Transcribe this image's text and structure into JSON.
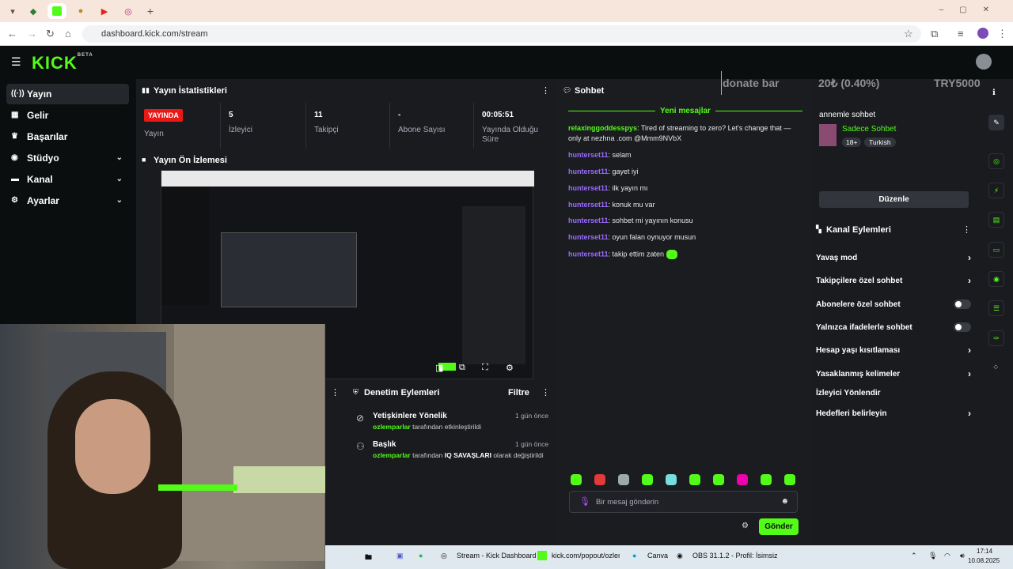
{
  "browser": {
    "url": "dashboard.kick.com/stream",
    "new_tab": "+"
  },
  "kick": {
    "logo": "KICK",
    "logo_sup": "BETA"
  },
  "sidebar": {
    "items": [
      {
        "label": "Yayın",
        "icon": "broadcast-icon"
      },
      {
        "label": "Gelir",
        "icon": "revenue-icon"
      },
      {
        "label": "Başarılar",
        "icon": "trophy-icon"
      },
      {
        "label": "Stüdyo",
        "icon": "studio-icon"
      },
      {
        "label": "Kanal",
        "icon": "channel-icon"
      },
      {
        "label": "Ayarlar",
        "icon": "gear-icon"
      }
    ]
  },
  "stats": {
    "title": "Yayın İstatistikleri",
    "live_badge": "YAYINDA",
    "live_label": "Yayın",
    "viewers_num": "5",
    "viewers_label": "İzleyici",
    "followers_num": "11",
    "followers_label": "Takipçi",
    "subs_num": "-",
    "subs_label": "Abone Sayısı",
    "uptime_num": "00:05:51",
    "uptime_label": "Yayında Olduğu Süre"
  },
  "preview": {
    "title": "Yayın Ön İzlemesi"
  },
  "mod": {
    "title": "Denetim Eylemleri",
    "filter": "Filtre",
    "actions": [
      {
        "title": "Yetişkinlere Yönelik",
        "time": "1 gün önce",
        "user": "ozlemparlar",
        "text": "tarafından etkinleştirildi"
      },
      {
        "title": "Başlık",
        "time": "1 gün önce",
        "user": "ozlemparlar",
        "text_pre": "tarafından",
        "bold": "IQ SAVAŞLARI",
        "text_post": "olarak değiştirildi"
      }
    ]
  },
  "chat": {
    "title": "Sohbet",
    "new_messages": "Yeni mesajlar",
    "messages": [
      {
        "user": "relaxinggoddesspys",
        "text": ": Tired of streaming to zero? Let's change that — only at nezhna .com @Mmm9NVbX"
      },
      {
        "user": "hunterset11",
        "text": ": selam"
      },
      {
        "user": "hunterset11",
        "text": ": gayet iyi"
      },
      {
        "user": "hunterset11",
        "text": ": ilk yayın mı"
      },
      {
        "user": "hunterset11",
        "text": ": konuk mu var"
      },
      {
        "user": "hunterset11",
        "text": ": sohbet mi yayının konusu"
      },
      {
        "user": "hunterset11",
        "text": ": oyun falan oynuyor musun"
      },
      {
        "user": "hunterset11",
        "text": ": takip ettim zaten"
      }
    ],
    "input_placeholder": "Bir mesaj gönderin",
    "send": "Gönder"
  },
  "donate": {
    "label": "donate bar",
    "amount": "20₺ (0.40%)",
    "goal": "TRY5000",
    "progress_fraction": 0.004
  },
  "stream_info": {
    "title": "annemle sohbet",
    "category": "Sadece Sohbet",
    "tags": [
      "18+",
      "Turkish"
    ],
    "edit": "Düzenle"
  },
  "channel_actions": {
    "title": "Kanal Eylemleri",
    "rows": [
      {
        "label": "Yavaş mod",
        "kind": "arrow"
      },
      {
        "label": "Takipçilere özel sohbet",
        "kind": "arrow"
      },
      {
        "label": "Abonelere özel sohbet",
        "kind": "toggle"
      },
      {
        "label": "Yalnızca ifadelerle sohbet",
        "kind": "toggle"
      },
      {
        "label": "Hesap yaşı kısıtlaması",
        "kind": "arrow"
      },
      {
        "label": "Yasaklanmış kelimeler",
        "kind": "arrow"
      },
      {
        "label": "İzleyici Yönlendir",
        "kind": "none"
      },
      {
        "label": "Hedefleri belirleyin",
        "kind": "arrow"
      }
    ]
  },
  "taskbar": {
    "items": [
      "Stream - Kick Dashboard",
      "kick.com/popout/ozlem",
      "Canva",
      "OBS 31.1.2 - Profil: İsimsiz"
    ],
    "time": "17:14",
    "date": "10.08.2025"
  },
  "colors": {
    "accent": "#53fc18",
    "live": "#e91916",
    "username": "#9b6bff"
  }
}
